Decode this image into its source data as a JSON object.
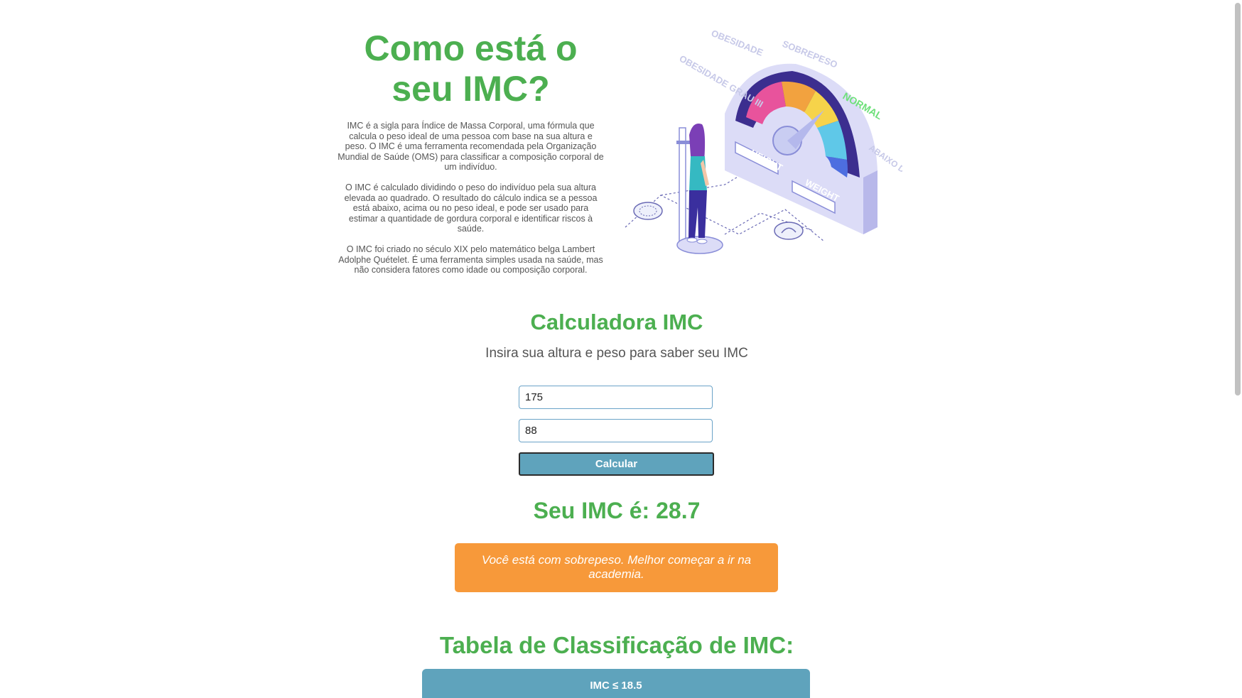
{
  "hero": {
    "title": "Como está o seu IMC?",
    "paragraphs": [
      "IMC é a sigla para Índice de Massa Corporal, uma fórmula que calcula o peso ideal de uma pessoa com base na sua altura e peso. O IMC é uma ferramenta recomendada pela Organização Mundial de Saúde (OMS) para classificar a composição corporal de um indivíduo.",
      "O IMC é calculado dividindo o peso do indivíduo pela sua altura elevada ao quadrado. O resultado do cálculo indica se a pessoa está abaixo, acima ou no peso ideal, e pode ser usado para estimar a quantidade de gordura corporal e identificar riscos à saúde.",
      "O IMC foi criado no século XIX pelo matemático belga Lambert Adolphe Quételet. É uma ferramenta simples usada na saúde, mas não considera fatores como idade ou composição corporal."
    ]
  },
  "illustration": {
    "labels": {
      "obesidade": "OBESIDADE",
      "sobrepeso": "SOBREPESO",
      "obesidade_grau": "OBESIDADE GRAU III",
      "normal": "NORMAL",
      "abaixo": "ABAIXO DO PESO",
      "height": "HEIGHT",
      "weight": "WEIGHT"
    },
    "colors": {
      "gauge_base": "#dcdcf7",
      "gauge_dark": "#3c2e8f",
      "normal_label": "#6ee07a",
      "person_shirt": "#35b9c2",
      "person_hair": "#7b3fb6",
      "person_pants": "#3a2f9e"
    }
  },
  "calculator": {
    "title": "Calculadora IMC",
    "subtitle": "Insira sua altura e peso para saber seu IMC",
    "height_value": "175",
    "weight_value": "88",
    "button_label": "Calcular"
  },
  "result": {
    "title": "Seu IMC é: 28.7",
    "message": "Você está com sobrepeso. Melhor começar a ir na academia.",
    "message_color": "#f7993a"
  },
  "table": {
    "title": "Tabela de Classificação de IMC:",
    "first_row_label": "IMC ≤ 18.5",
    "header_color": "#5fa3bc"
  },
  "theme": {
    "accent": "#4caf50",
    "text": "#555555"
  }
}
